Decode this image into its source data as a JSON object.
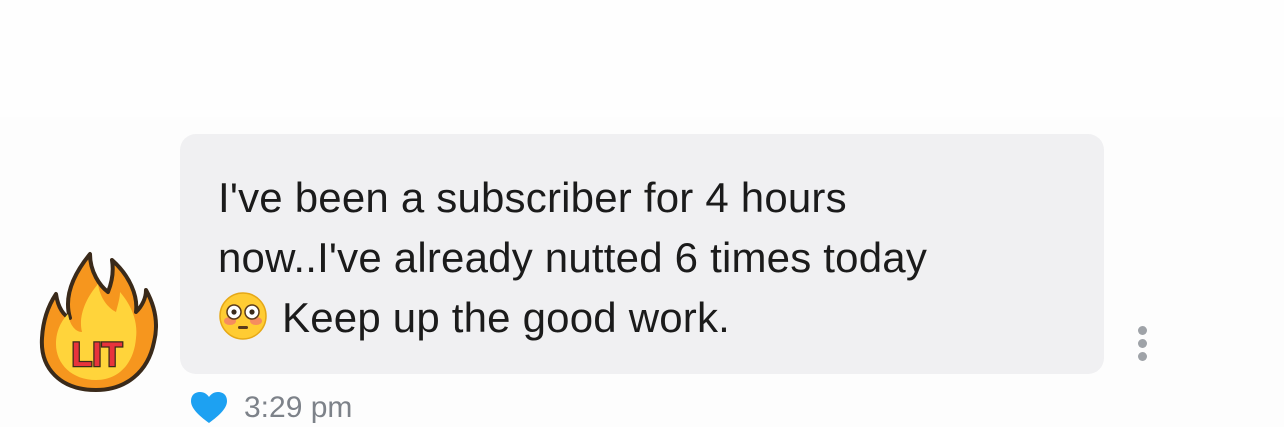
{
  "message": {
    "lines": [
      "I've been a subscriber for 4 hours",
      "now..I've already nutted 6 times today",
      "Keep up the good work."
    ],
    "emoji": "flushed-face",
    "timestamp": "3:29 pm"
  },
  "avatar": {
    "icon": "lit-fire-icon",
    "label": "LIT"
  },
  "reactions": {
    "icon": "heart-icon",
    "color": "#1da1f2"
  },
  "colors": {
    "bubble": "#f0f0f2",
    "text": "#1b1b1b",
    "timestamp": "#7d8289",
    "heart": "#1da1f2",
    "more_dots": "#9fa3a8"
  }
}
